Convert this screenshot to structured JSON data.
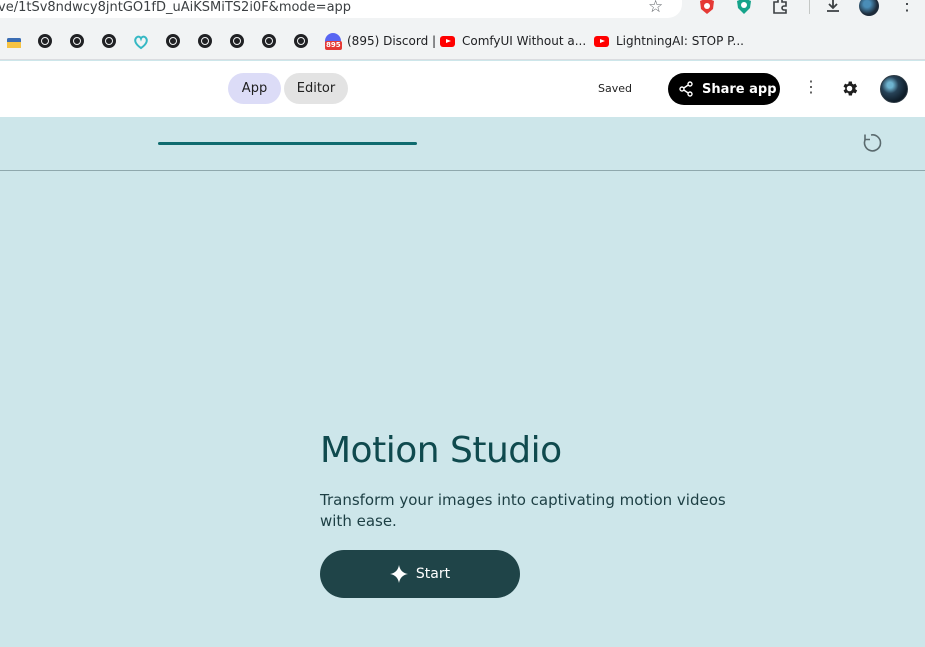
{
  "browser": {
    "url": "ve/1tSv8ndwcy8jntGO1fD_uAiKSMiTS2i0F&mode=app",
    "bookmarks": [
      {
        "label": "",
        "icon": "folder-icon"
      },
      {
        "label": "",
        "icon": "globe-icon"
      },
      {
        "label": "",
        "icon": "globe-icon"
      },
      {
        "label": "",
        "icon": "globe-icon"
      },
      {
        "label": "",
        "icon": "heart-logo-icon"
      },
      {
        "label": "",
        "icon": "globe-icon"
      },
      {
        "label": "",
        "icon": "globe-icon"
      },
      {
        "label": "",
        "icon": "globe-icon"
      },
      {
        "label": "",
        "icon": "globe-icon"
      },
      {
        "label": "",
        "icon": "globe-icon"
      },
      {
        "label": "(895) Discord |",
        "icon": "discord-icon",
        "badge": "895"
      },
      {
        "label": "ComfyUI Without a...",
        "icon": "youtube-icon"
      },
      {
        "label": "LightningAI: STOP P...",
        "icon": "youtube-icon"
      }
    ]
  },
  "header": {
    "tabs": [
      {
        "label": "App"
      },
      {
        "label": "Editor"
      }
    ],
    "saved_label": "Saved",
    "share_label": "Share app"
  },
  "progress": {
    "fraction": 0.28
  },
  "hero": {
    "title": "Motion Studio",
    "subtitle": "Transform your images into captivating motion videos with ease.",
    "start_label": "Start"
  },
  "colors": {
    "background": "#cde6ea",
    "accent": "#0f6b6f",
    "button": "#1f4448",
    "title": "#0f4a4e"
  }
}
